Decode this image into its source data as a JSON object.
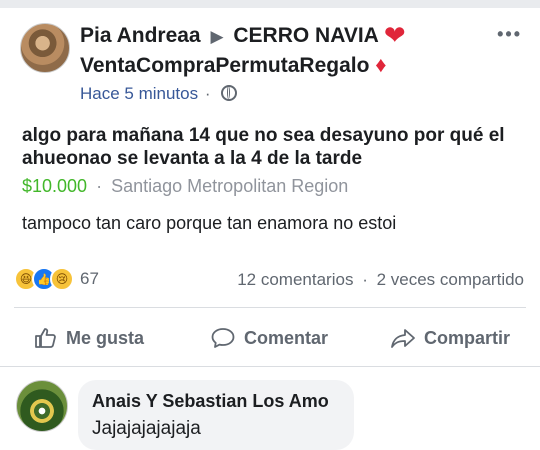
{
  "post": {
    "author": "Pia Andreaa",
    "arrow": "▶",
    "group_part1": "CERRO NAVIA",
    "heart": "❤",
    "group_part2": "VentaCompraPermutaRegalo",
    "diamond": "♦",
    "timestamp": "Hace 5 minutos",
    "meta_dot": "·",
    "more_label": "•••",
    "title": "algo para mañana 14 que no sea desayuno por qué el ahueonao se levanta a la 4 de la tarde",
    "price": "$10.000",
    "location_sep": "·",
    "location": "Santiago Metropolitan Region",
    "description": "tampoco tan caro porque tan enamora no estoi"
  },
  "stats": {
    "reactions": [
      "haha-icon",
      "like-icon",
      "sad-icon"
    ],
    "reaction_count": "67",
    "comments": "12 comentarios",
    "sep": "·",
    "shares": "2 veces compartido"
  },
  "actions": {
    "like": "Me gusta",
    "comment": "Comentar",
    "share": "Compartir"
  },
  "comment": {
    "author": "Anais Y Sebastian Los Amo",
    "text": "Jajajajajajaja"
  },
  "colors": {
    "link_blue": "#385898",
    "price_green": "#42b72a",
    "heart_red": "#e0263a",
    "muted_gray": "#606770"
  }
}
